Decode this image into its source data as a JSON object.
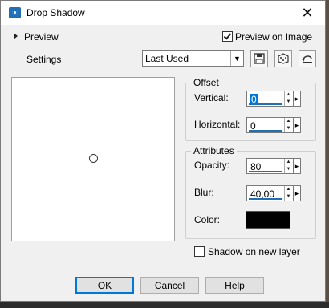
{
  "window": {
    "title": "Drop Shadow",
    "close_glyph": "✕"
  },
  "preview_toggle": {
    "label": "Preview"
  },
  "preview_on_image": {
    "label": "Preview on Image",
    "checked": true
  },
  "settings": {
    "label": "Settings",
    "value": "Last Used"
  },
  "toolbar": {
    "icons": [
      "save-preset-icon",
      "randomize-icon",
      "reset-icon"
    ]
  },
  "offset": {
    "title": "Offset",
    "vertical": {
      "label": "Vertical:",
      "value": "0"
    },
    "horizontal": {
      "label": "Horizontal:",
      "value": "0"
    }
  },
  "attributes": {
    "title": "Attributes",
    "opacity": {
      "label": "Opacity:",
      "value": "80"
    },
    "blur": {
      "label": "Blur:",
      "value": "40,00"
    },
    "color": {
      "label": "Color:",
      "value": "#000000"
    }
  },
  "shadow_new_layer": {
    "label": "Shadow on new layer",
    "checked": false
  },
  "buttons": {
    "ok": "OK",
    "cancel": "Cancel",
    "help": "Help"
  }
}
